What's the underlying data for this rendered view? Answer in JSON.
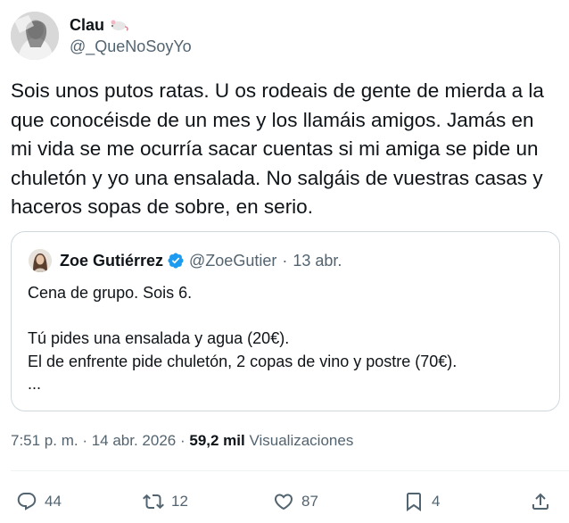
{
  "author": {
    "display_name": "Clau",
    "name_emoji": "mouse-emoji",
    "handle": "@_QueNoSoyYo"
  },
  "tweet": {
    "text": "Sois unos putos ratas. U os rodeais de gente de mierda a la que conocéisde de un mes y los llamáis amigos. Jamás en mi vida se me ocurría sacar cuentas si mi amiga se pide un chuletón y yo una ensalada. No salgáis de vuestras casas y haceros sopas de sobre, en serio."
  },
  "quote": {
    "display_name": "Zoe Gutiérrez",
    "verified": true,
    "handle": "@ZoeGutier",
    "separator": "·",
    "date": "13 abr.",
    "lines": [
      "Cena de grupo. Sois 6.",
      "",
      "Tú pides una ensalada y agua (20€).",
      "El de enfrente pide chuletón, 2 copas de vino y postre (70€).",
      "..."
    ]
  },
  "meta": {
    "time": "7:51 p. m.",
    "separator1": " · ",
    "date": "14 abr. 2026",
    "separator2": " · ",
    "views_count": "59,2 mil",
    "views_label": " Visualizaciones"
  },
  "actions": {
    "replies": "44",
    "retweets": "12",
    "likes": "87",
    "bookmarks": "4"
  },
  "colors": {
    "text": "#0f1419",
    "secondary": "#536471",
    "border": "#cfd9de",
    "verified": "#1d9bf0"
  }
}
